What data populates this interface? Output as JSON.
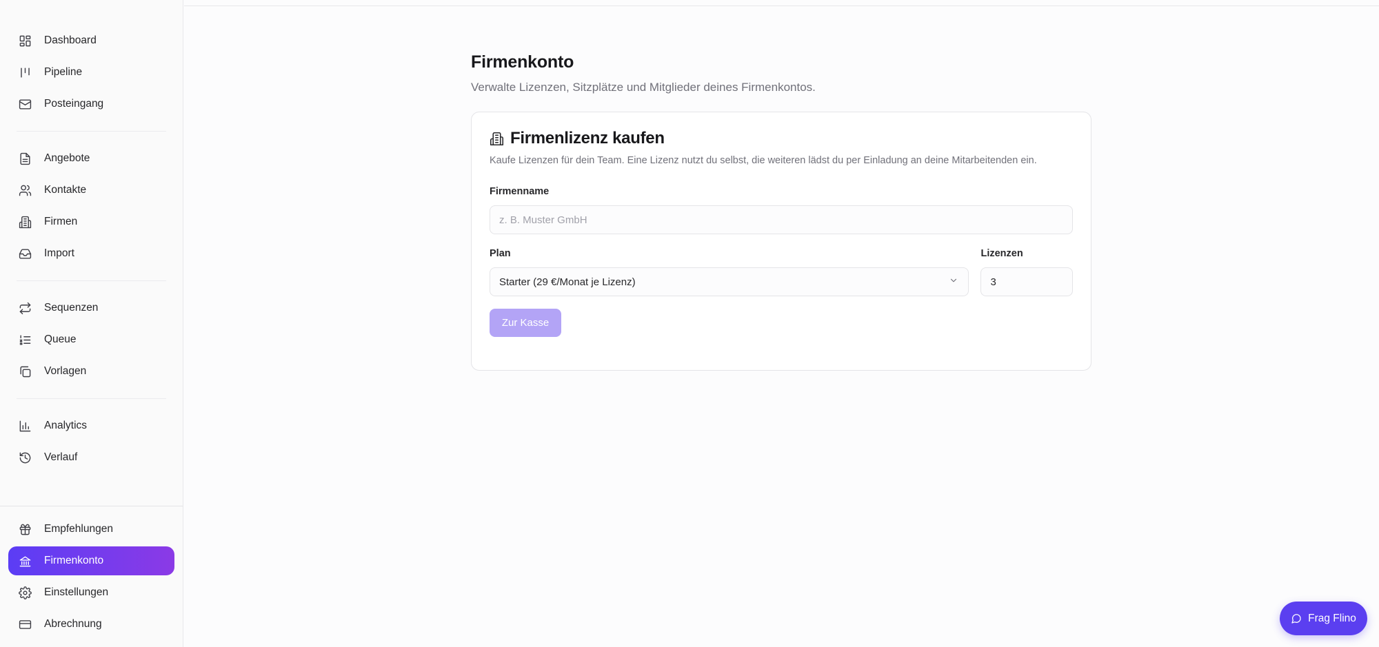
{
  "sidebar": {
    "groups": [
      {
        "items": [
          {
            "label": "Dashboard",
            "icon": "dashboard-icon"
          },
          {
            "label": "Pipeline",
            "icon": "pipeline-icon"
          },
          {
            "label": "Posteingang",
            "icon": "mail-icon"
          }
        ]
      },
      {
        "items": [
          {
            "label": "Angebote",
            "icon": "document-icon"
          },
          {
            "label": "Kontakte",
            "icon": "users-icon"
          },
          {
            "label": "Firmen",
            "icon": "building-icon"
          },
          {
            "label": "Import",
            "icon": "inbox-icon"
          }
        ]
      },
      {
        "items": [
          {
            "label": "Sequenzen",
            "icon": "repeat-icon"
          },
          {
            "label": "Queue",
            "icon": "list-ordered-icon"
          },
          {
            "label": "Vorlagen",
            "icon": "copy-icon"
          }
        ]
      },
      {
        "items": [
          {
            "label": "Analytics",
            "icon": "bar-chart-icon"
          },
          {
            "label": "Verlauf",
            "icon": "history-icon"
          }
        ]
      }
    ],
    "bottom_items": [
      {
        "label": "Empfehlungen",
        "icon": "gift-icon"
      },
      {
        "label": "Firmenkonto",
        "icon": "bank-icon",
        "active": true
      },
      {
        "label": "Einstellungen",
        "icon": "gear-icon"
      },
      {
        "label": "Abrechnung",
        "icon": "credit-card-icon"
      }
    ]
  },
  "page": {
    "title": "Firmenkonto",
    "subtitle": "Verwalte Lizenzen, Sitzplätze und Mitglieder deines Firmenkontos."
  },
  "card": {
    "title": "Firmenlizenz kaufen",
    "icon": "building-icon",
    "description": "Kaufe Lizenzen für dein Team. Eine Lizenz nutzt du selbst, die weiteren lädst du per Einladung an deine Mitarbeitenden ein.",
    "company_name": {
      "label": "Firmenname",
      "placeholder": "z. B. Muster GmbH",
      "value": ""
    },
    "plan": {
      "label": "Plan",
      "selected": "Starter (29 €/Monat je Lizenz)"
    },
    "licenses": {
      "label": "Lizenzen",
      "value": "3"
    },
    "checkout_label": "Zur Kasse"
  },
  "fab": {
    "label": "Frag Flino",
    "icon": "chat-icon"
  },
  "colors": {
    "accent": "#5b3df5",
    "accent_gradient_end": "#8b3ae6",
    "button_disabled": "#b3a4f6"
  }
}
